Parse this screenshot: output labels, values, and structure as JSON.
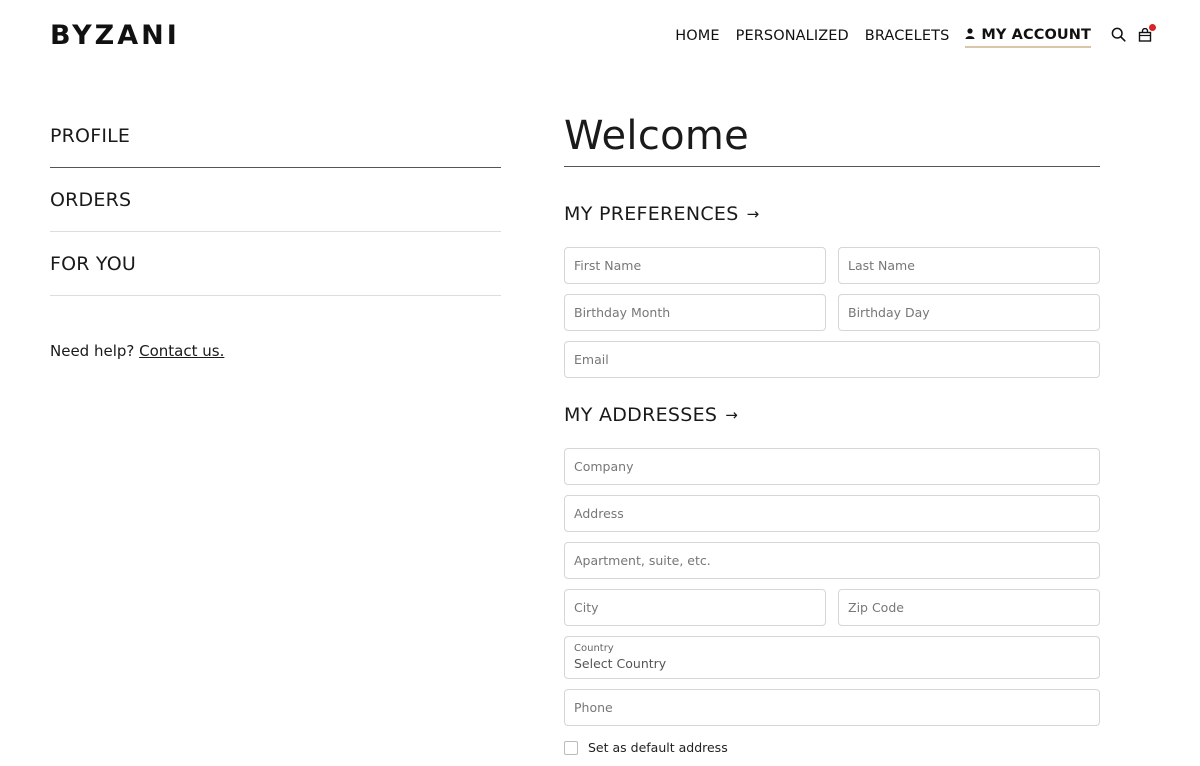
{
  "header": {
    "logo": "BYZANI",
    "nav": [
      {
        "label": "HOME"
      },
      {
        "label": "PERSONALIZED"
      },
      {
        "label": "BRACELETS"
      },
      {
        "label": "MY ACCOUNT"
      }
    ],
    "icons": [
      "person-icon",
      "search-icon",
      "cart-icon"
    ],
    "cart_badge_color": "#d8232a",
    "active_underline_color": "#d9c6a8"
  },
  "sidebar": {
    "items": [
      {
        "label": "PROFILE"
      },
      {
        "label": "ORDERS"
      },
      {
        "label": "FOR YOU"
      }
    ],
    "help_text": "Need help?",
    "help_link": "Contact us."
  },
  "main": {
    "title": "Welcome",
    "preferences": {
      "title": "MY PREFERENCES",
      "arrow": "→",
      "first_name_placeholder": "First Name",
      "last_name_placeholder": "Last Name",
      "birthday_month_placeholder": "Birthday Month",
      "birthday_day_placeholder": "Birthday Day",
      "email_placeholder": "Email"
    },
    "addresses": {
      "title": "MY ADDRESSES",
      "arrow": "→",
      "company_placeholder": "Company",
      "address_placeholder": "Address",
      "apartment_placeholder": "Apartment, suite, etc.",
      "city_placeholder": "City",
      "zip_placeholder": "Zip Code",
      "country_label": "Country",
      "country_value": "Select Country",
      "phone_placeholder": "Phone",
      "default_checkbox_label": "Set as default address"
    }
  }
}
